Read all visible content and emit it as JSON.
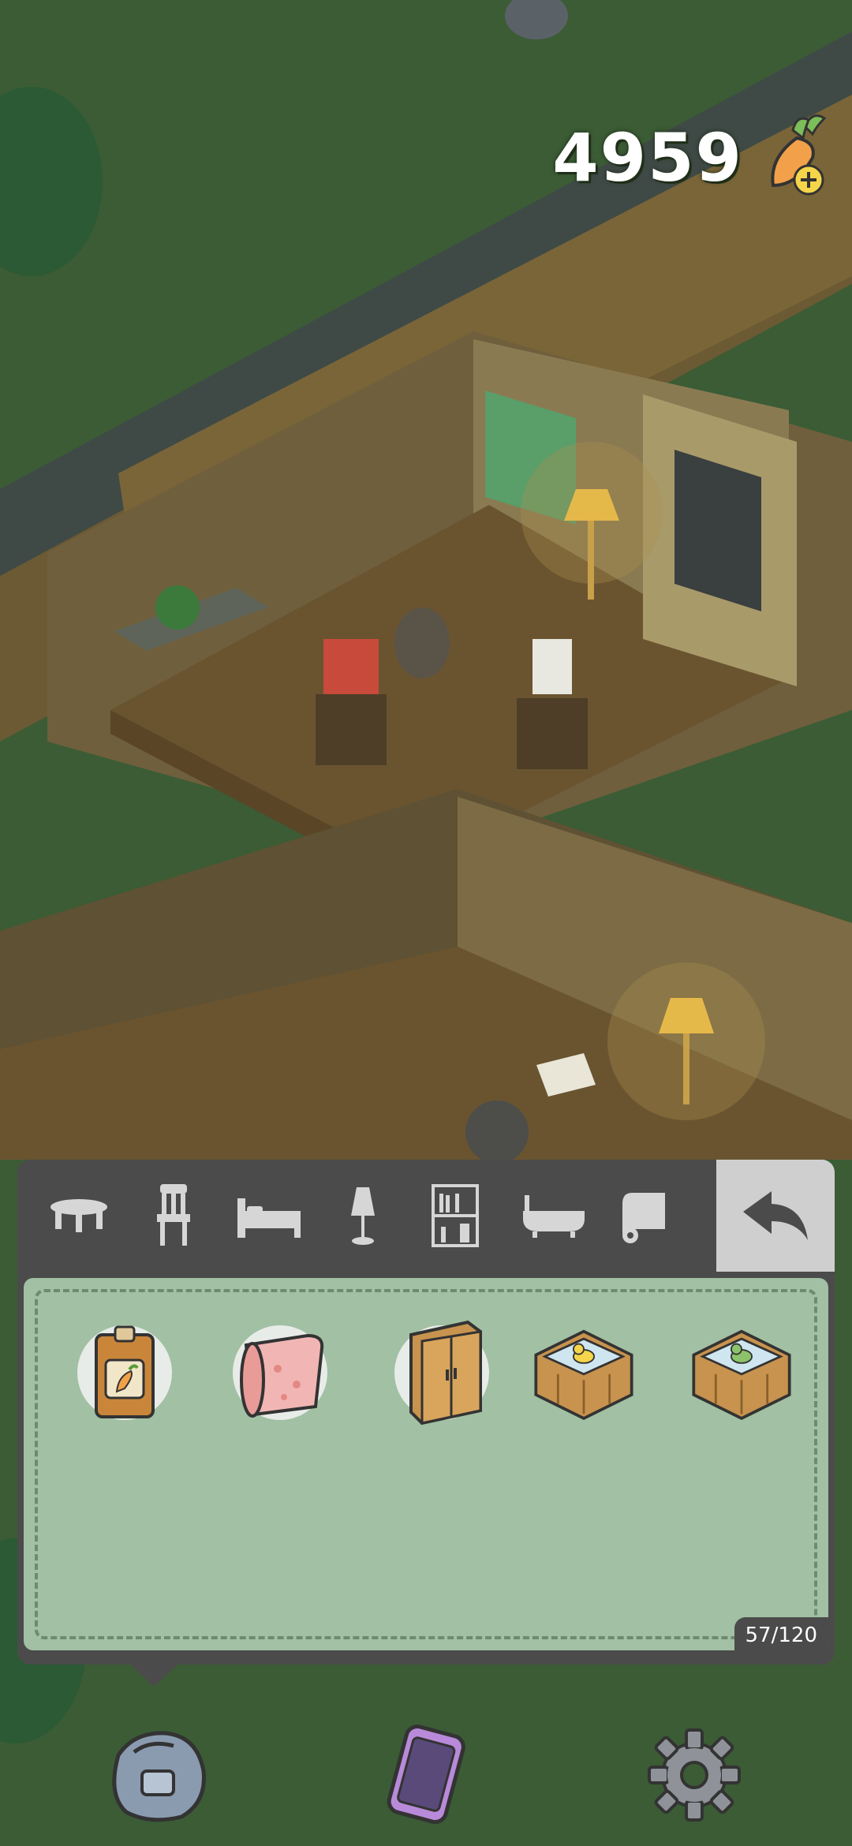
{
  "currency": {
    "amount": "4959",
    "icon": "carrot-add-icon"
  },
  "tabs": [
    {
      "name": "table-tab",
      "icon": "table-icon"
    },
    {
      "name": "chair-tab",
      "icon": "chair-icon"
    },
    {
      "name": "bed-tab",
      "icon": "bed-icon"
    },
    {
      "name": "lamp-tab",
      "icon": "lamp-icon"
    },
    {
      "name": "shelf-tab",
      "icon": "shelf-icon"
    },
    {
      "name": "bathtub-tab",
      "icon": "bathtub-icon"
    },
    {
      "name": "rug-tab",
      "icon": "rug-icon"
    }
  ],
  "inventory": {
    "items": [
      {
        "name": "carrot-seed-packet",
        "icon": "seed-packet-icon"
      },
      {
        "name": "pink-rug-roll",
        "icon": "rug-roll-icon"
      },
      {
        "name": "wooden-wardrobe",
        "icon": "wardrobe-icon"
      },
      {
        "name": "duck-tub-yellow",
        "icon": "duck-tub-icon"
      },
      {
        "name": "duck-tub-green",
        "icon": "duck-tub-icon"
      }
    ],
    "count": "57/120"
  },
  "bottom_nav": [
    {
      "name": "backpack-button",
      "icon": "backpack-icon"
    },
    {
      "name": "phone-button",
      "icon": "phone-icon"
    },
    {
      "name": "settings-button",
      "icon": "gear-icon"
    }
  ]
}
